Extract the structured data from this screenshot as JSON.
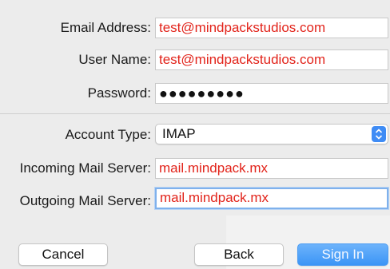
{
  "form": {
    "email_label": "Email Address:",
    "email_value": "test@mindpackstudios.com",
    "username_label": "User Name:",
    "username_value": "test@mindpackstudios.com",
    "password_label": "Password:",
    "password_value": "●●●●●●●●●",
    "account_type_label": "Account Type:",
    "account_type_value": "IMAP",
    "incoming_label": "Incoming Mail Server:",
    "incoming_value": "mail.mindpack.mx",
    "outgoing_label": "Outgoing Mail Server:",
    "outgoing_value": "mail.mindpack.mx"
  },
  "buttons": {
    "cancel": "Cancel",
    "back": "Back",
    "sign_in": "Sign In"
  },
  "icons": {
    "select_stepper": "chevron-up-down-icon"
  },
  "colors": {
    "field_text": "#e2231a",
    "accent": "#3f8cf5",
    "focus_ring": "#7fb1ec"
  }
}
